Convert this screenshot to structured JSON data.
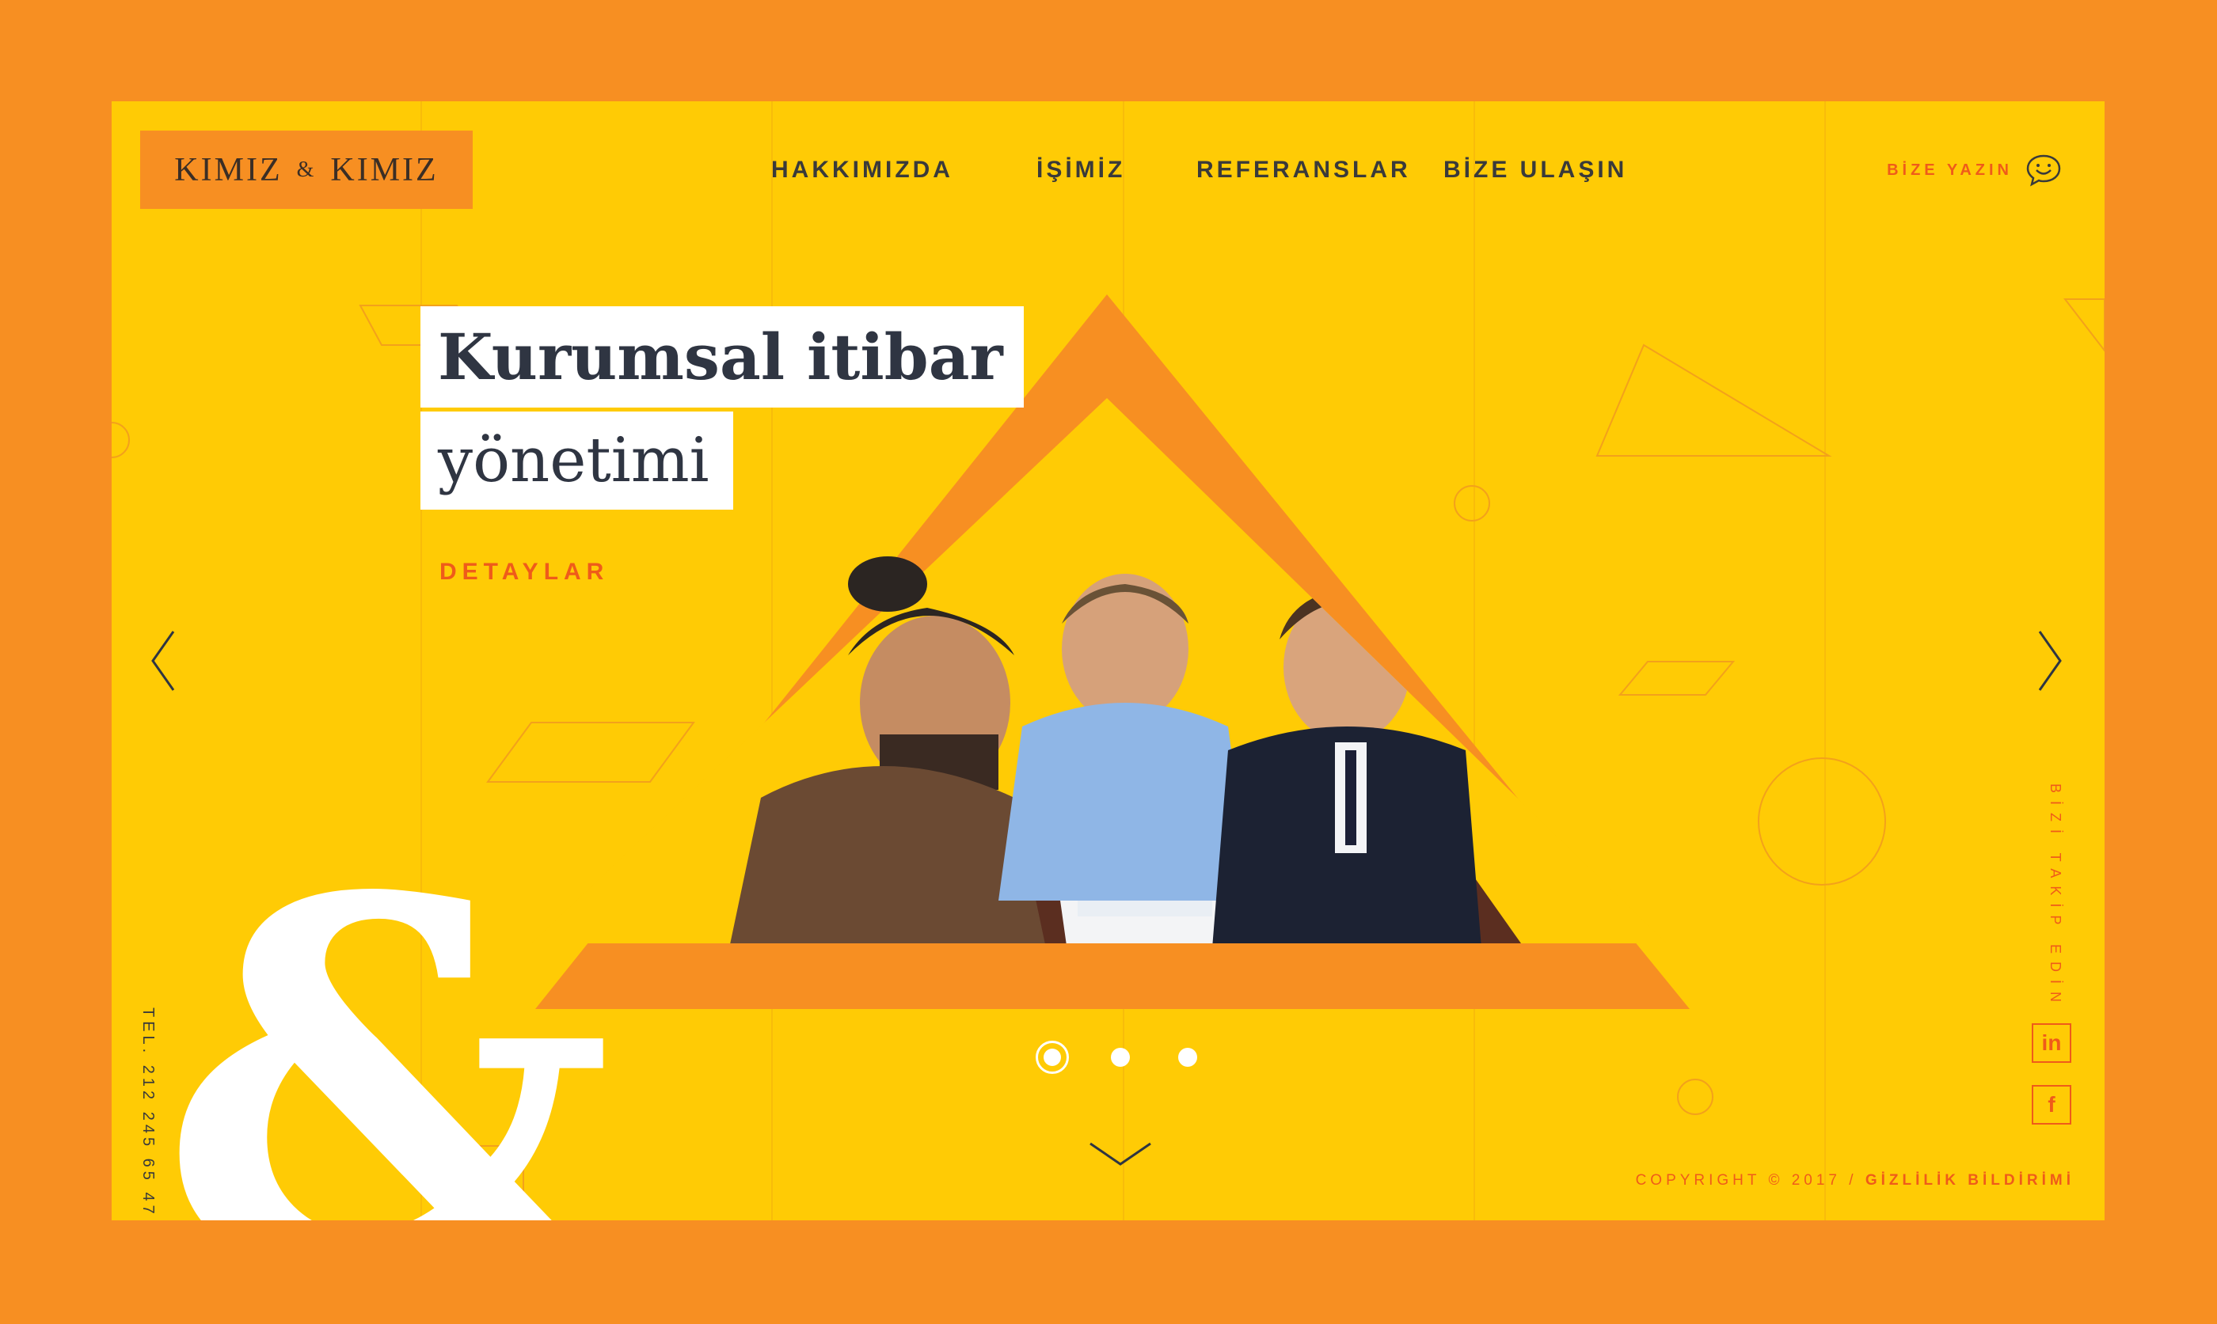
{
  "logo": {
    "left": "KIMIZ",
    "amp": "&",
    "right": "KIMIZ"
  },
  "nav": [
    {
      "label": "HAKKIMIZDA"
    },
    {
      "label": "İŞİMİZ"
    },
    {
      "label": "REFERANSLAR"
    },
    {
      "label": "BİZE ULAŞIN"
    }
  ],
  "cta": {
    "label": "BİZE YAZIN",
    "icon": "chat-smile-icon"
  },
  "hero": {
    "headline_line1": "Kurumsal itibar",
    "headline_line2": "yönetimi",
    "details_label": "DETAYLAR",
    "ampersand": "&"
  },
  "slider": {
    "slides": 3,
    "active": 1,
    "prev_icon": "chevron-left-icon",
    "next_icon": "chevron-right-icon",
    "scroll_icon": "chevron-down-icon"
  },
  "contact": {
    "phone": "TEL. 212 245 65 47"
  },
  "social": {
    "title": "BİZİ TAKİP EDİN",
    "linkedin": "in",
    "facebook": "f"
  },
  "footer": {
    "copyright": "COPYRIGHT © 2017 /",
    "privacy": "GİZLİLİK BİLDİRİMİ"
  },
  "colors": {
    "outer": "#f78f22",
    "background": "#ffcb05",
    "accent": "#ef5b1a",
    "text": "#2f3542",
    "white": "#ffffff"
  }
}
